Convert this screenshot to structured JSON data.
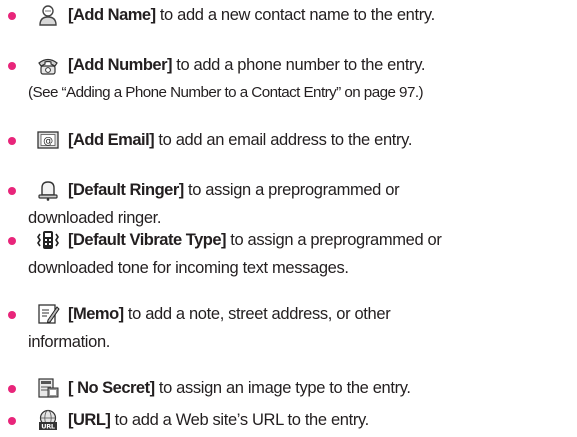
{
  "bullet_color": "#e8257a",
  "items": [
    {
      "icon": "add-name-person-icon",
      "label": "[Add Name]",
      "text": "to add a new contact name to the entry.",
      "line2": ""
    },
    {
      "icon": "phone-handset-icon",
      "label": "[Add Number]",
      "text": "to add a phone number to the entry.",
      "line2": "(See “Adding a Phone Number to a Contact Entry” on page 97.)"
    },
    {
      "icon": "email-at-icon",
      "label": "[Add Email]",
      "text": "to add an email address to the entry.",
      "line2": ""
    },
    {
      "icon": "ringer-bell-icon",
      "label": "[Default Ringer]",
      "text": "to assign a preprogrammed or",
      "line2": "downloaded ringer."
    },
    {
      "icon": "vibrate-phone-icon",
      "label": "[Default  Vibrate Type]",
      "text": "to assign a preprogrammed or",
      "line2": "downloaded tone for incoming text messages."
    },
    {
      "icon": "memo-pencil-icon",
      "label": "[Memo]",
      "text": "to add a note, street address, or other",
      "line2": "information."
    },
    {
      "icon": "image-type-icon",
      "label": "[ No Secret]",
      "text": "to assign an image type to the entry.",
      "line2": ""
    },
    {
      "icon": "url-globe-icon",
      "label": "[URL]",
      "text": "to add a Web site’s URL to the entry.",
      "line2": ""
    }
  ]
}
